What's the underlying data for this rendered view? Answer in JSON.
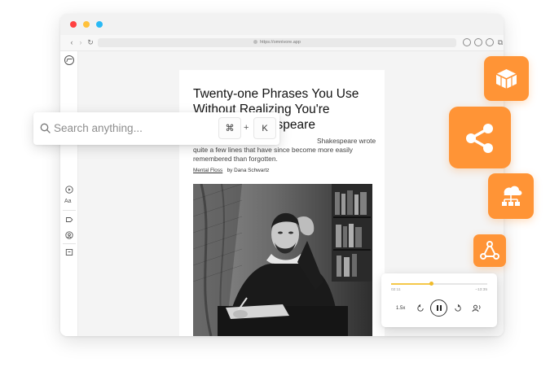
{
  "browser": {
    "url": "https://omnivore.app",
    "traffic_lights": {
      "close": "#ff4141",
      "minimize": "#ffc13b",
      "maximize": "#29b9f5"
    }
  },
  "sidebar": {
    "items": [
      {
        "name": "omnivore-logo-icon"
      },
      {
        "name": "play-icon"
      },
      {
        "name": "text-style-icon",
        "label": "Aa"
      },
      {
        "name": "label-tag-icon"
      },
      {
        "name": "at-icon"
      },
      {
        "name": "archive-icon"
      }
    ]
  },
  "article": {
    "title": "Twenty-one Phrases You Use Without Realizing You're Quoting Shakespeare",
    "description": "quite a few lines that have since become more easily remembered than forgotten.",
    "description_visible_start": "Shakespeare wrote",
    "source": "Mental Floss",
    "byline": "by Dana Schwartz"
  },
  "search": {
    "placeholder": "Search anything...",
    "shortcut_modifier": "⌘",
    "shortcut_plus": "+",
    "shortcut_key": "K"
  },
  "integration_tiles": {
    "accent": "#ff9436",
    "icons": [
      "cube-blocks-icon",
      "share-icon",
      "sitemap-icon",
      "webhook-icon"
    ]
  },
  "player": {
    "elapsed": "02:11",
    "remaining": "−13:35",
    "progress": 0.42,
    "speed": "1.5x",
    "accent": "#f5c84a"
  }
}
